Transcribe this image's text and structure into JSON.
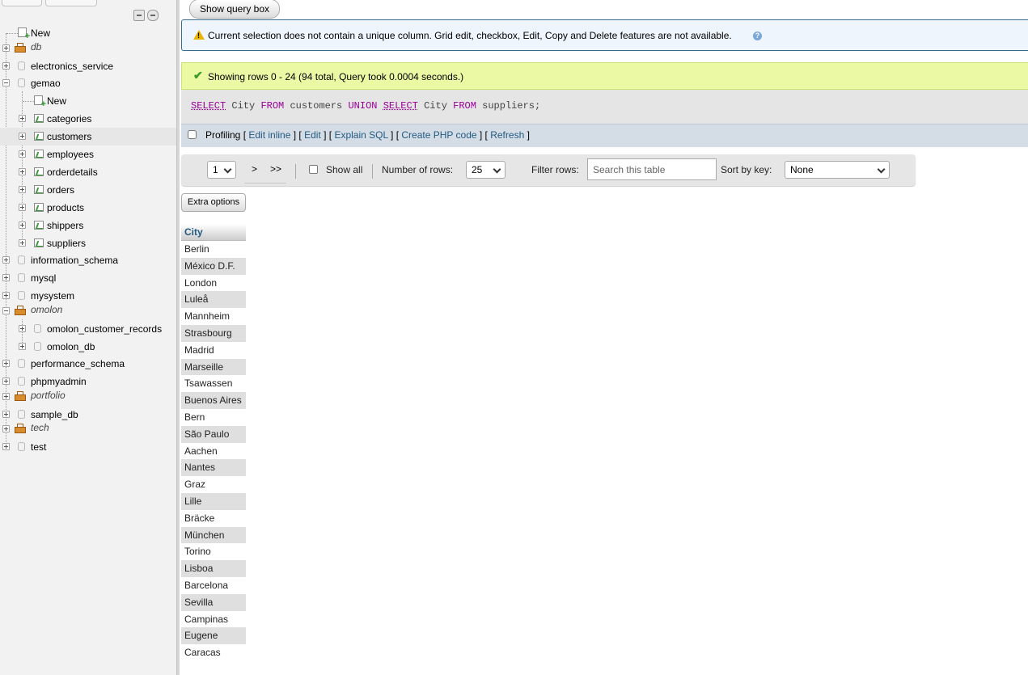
{
  "nav": {
    "tree": [
      {
        "label": "New",
        "kind": "new",
        "level": 0
      },
      {
        "label": "db",
        "kind": "group",
        "level": 0
      },
      {
        "label": "electronics_service",
        "kind": "db",
        "level": 0
      },
      {
        "label": "gemao",
        "kind": "db-open",
        "level": 0
      },
      {
        "label": "New",
        "kind": "new",
        "level": 1
      },
      {
        "label": "categories",
        "kind": "table",
        "level": 1
      },
      {
        "label": "customers",
        "kind": "table",
        "level": 1,
        "highlighted": true
      },
      {
        "label": "employees",
        "kind": "table",
        "level": 1
      },
      {
        "label": "orderdetails",
        "kind": "table",
        "level": 1
      },
      {
        "label": "orders",
        "kind": "table",
        "level": 1
      },
      {
        "label": "products",
        "kind": "table",
        "level": 1
      },
      {
        "label": "shippers",
        "kind": "table",
        "level": 1
      },
      {
        "label": "suppliers",
        "kind": "table",
        "level": 1
      },
      {
        "label": "information_schema",
        "kind": "db",
        "level": 0
      },
      {
        "label": "mysql",
        "kind": "db",
        "level": 0
      },
      {
        "label": "mysystem",
        "kind": "db",
        "level": 0
      },
      {
        "label": "omolon",
        "kind": "group-open",
        "level": 0
      },
      {
        "label": "omolon_customer_records",
        "kind": "db",
        "level": 1
      },
      {
        "label": "omolon_db",
        "kind": "db",
        "level": 1
      },
      {
        "label": "performance_schema",
        "kind": "db",
        "level": 0
      },
      {
        "label": "phpmyadmin",
        "kind": "db",
        "level": 0
      },
      {
        "label": "portfolio",
        "kind": "group",
        "level": 0
      },
      {
        "label": "sample_db",
        "kind": "db",
        "level": 0
      },
      {
        "label": "tech",
        "kind": "group",
        "level": 0
      },
      {
        "label": "test",
        "kind": "db",
        "level": 0
      }
    ]
  },
  "main": {
    "show_query_label": "Show query box",
    "notice": "Current selection does not contain a unique column. Grid edit, checkbox, Edit, Copy and Delete features are not available.",
    "notice_help": "?",
    "success": "Showing rows 0 - 24 (94 total, Query took 0.0004 seconds.)",
    "sql": {
      "kw1": "SELECT",
      "t1": " City ",
      "kw2": "FROM",
      "t2": " customers ",
      "kw3": "UNION",
      "t3": " ",
      "kw4": "SELECT",
      "t4": " City ",
      "kw5": "FROM",
      "t5": " suppliers;"
    },
    "profiling": {
      "label": "Profiling",
      "b1": " [ ",
      "edit_inline": "Edit inline",
      "b2": " ] [ ",
      "edit": "Edit",
      "b3": " ] [ ",
      "explain": "Explain SQL",
      "b4": " ] [ ",
      "php": "Create PHP code",
      "b5": " ] [ ",
      "refresh": "Refresh",
      "b6": " ]"
    },
    "pager": {
      "page": "1",
      "next": ">",
      "last": ">>",
      "show_all": "Show all",
      "rows_label": "Number of rows:",
      "rows_value": "25",
      "filter_label": "Filter rows:",
      "filter_placeholder": "Search this table",
      "sort_label": "Sort by key:",
      "sort_value": "None"
    },
    "extra_options": "Extra options",
    "table": {
      "header": "City",
      "rows": [
        "Berlin",
        "México D.F.",
        "London",
        "Luleå",
        "Mannheim",
        "Strasbourg",
        "Madrid",
        "Marseille",
        "Tsawassen",
        "Buenos Aires",
        "Bern",
        "São Paulo",
        "Aachen",
        "Nantes",
        "Graz",
        "Lille",
        "Bräcke",
        "München",
        "Torino",
        "Lisboa",
        "Barcelona",
        "Sevilla",
        "Campinas",
        "Eugene",
        "Caracas"
      ]
    }
  }
}
